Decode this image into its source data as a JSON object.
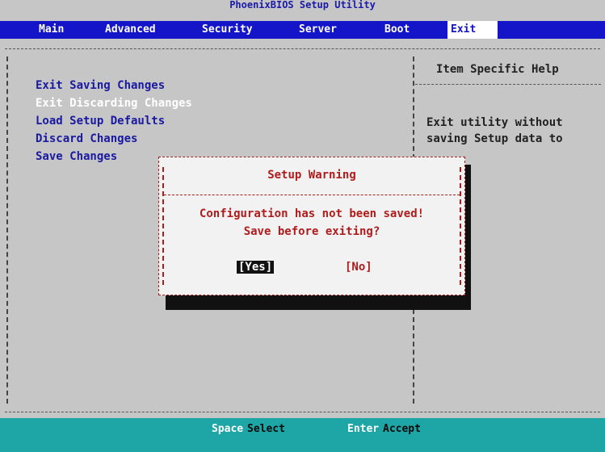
{
  "title": "PhoenixBIOS Setup Utility",
  "menu": {
    "items": [
      {
        "label": "Main"
      },
      {
        "label": "Advanced"
      },
      {
        "label": "Security"
      },
      {
        "label": "Server"
      },
      {
        "label": "Boot"
      },
      {
        "label": "Exit",
        "active": true
      }
    ]
  },
  "options": [
    {
      "label": "Exit Saving Changes"
    },
    {
      "label": "Exit Discarding Changes",
      "selected": true
    },
    {
      "label": "Load Setup Defaults"
    },
    {
      "label": "Discard Changes"
    },
    {
      "label": "Save Changes"
    }
  ],
  "help": {
    "title": "Item Specific Help",
    "lines": [
      "Exit utility without",
      "saving Setup data to"
    ]
  },
  "dialog": {
    "title": "Setup Warning",
    "message_line1": "Configuration has not been saved!",
    "message_line2": "Save before exiting?",
    "yes_label": "[Yes]",
    "no_label": "[No]"
  },
  "status": {
    "key1": "Space",
    "label1": "Select",
    "key2": "Enter",
    "label2": "Accept"
  },
  "colors": {
    "background": "#c6c6c6",
    "menubar": "#1414c8",
    "statusbar": "#1ea6a6",
    "dialog_text": "#b01c1c"
  }
}
